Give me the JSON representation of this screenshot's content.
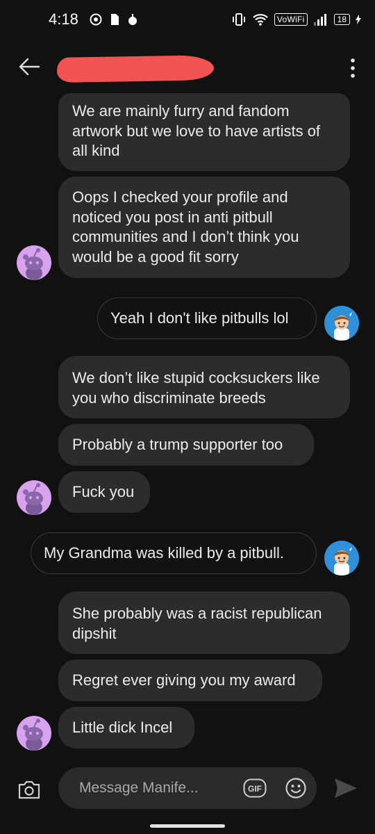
{
  "status_bar": {
    "time": "4:18",
    "network_label": "VoWiFi",
    "battery_level": "18"
  },
  "header": {
    "back_icon": "arrow-left-icon",
    "menu_icon": "more-vertical-icon"
  },
  "messages": [
    {
      "sender": "other",
      "text": "We are mainly furry and fandom artwork but we love to have artists of all kind"
    },
    {
      "sender": "other",
      "text": "Oops I checked your profile and noticed you post in anti pitbull communities and I don’t think you would be a good fit sorry"
    },
    {
      "sender": "me",
      "text": "Yeah I don't like pitbulls lol"
    },
    {
      "sender": "other",
      "text": "We don’t like stupid cocksuckers like you who discriminate breeds"
    },
    {
      "sender": "other",
      "text": "Probably a trump supporter too"
    },
    {
      "sender": "other",
      "text": "Fuck you"
    },
    {
      "sender": "me",
      "text": "My Grandma was killed by a pitbull."
    },
    {
      "sender": "other",
      "text": "She probably was a racist republican dipshit"
    },
    {
      "sender": "other",
      "text": "Regret ever giving you my award"
    },
    {
      "sender": "other",
      "text": "Little dick Incel"
    }
  ],
  "composer": {
    "placeholder": "Message Manife...",
    "gif_label": "GIF",
    "camera_icon": "camera-icon",
    "emoji_icon": "emoji-icon",
    "send_icon": "send-icon"
  },
  "colors": {
    "background": "#111111",
    "bubble": "#2c2c2c",
    "redaction": "#f25454",
    "snoo_avatar": "#d9a2ef",
    "user_avatar": "#2f8fd8"
  }
}
